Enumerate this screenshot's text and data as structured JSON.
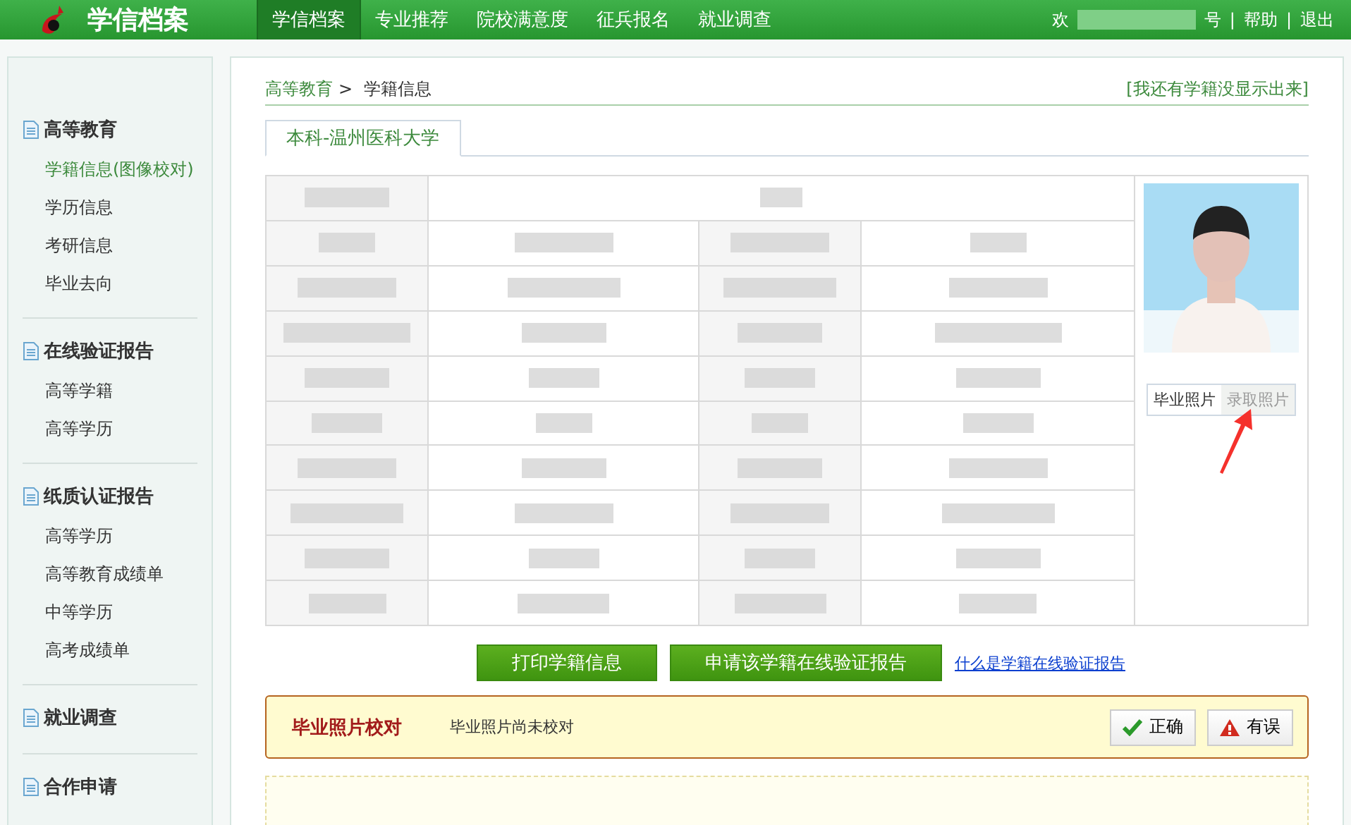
{
  "header": {
    "logo_text": "学信档案",
    "nav": [
      {
        "label": "学信档案",
        "selected": true
      },
      {
        "label": "专业推荐",
        "selected": false
      },
      {
        "label": "院校满意度",
        "selected": false
      },
      {
        "label": "征兵报名",
        "selected": false
      },
      {
        "label": "就业调查",
        "selected": false
      }
    ],
    "welcome_start": "欢",
    "welcome_end": "号",
    "links": [
      "帮助",
      "退出"
    ],
    "separator": "|"
  },
  "sidebar": [
    {
      "title": "高等教育",
      "items": [
        {
          "label": "学籍信息(图像校对)",
          "selected": true
        },
        {
          "label": "学历信息",
          "selected": false
        },
        {
          "label": "考研信息",
          "selected": false
        },
        {
          "label": "毕业去向",
          "selected": false
        }
      ]
    },
    {
      "title": "在线验证报告",
      "items": [
        {
          "label": "高等学籍",
          "selected": false
        },
        {
          "label": "高等学历",
          "selected": false
        }
      ]
    },
    {
      "title": "纸质认证报告",
      "items": [
        {
          "label": "高等学历",
          "selected": false
        },
        {
          "label": "高等教育成绩单",
          "selected": false
        },
        {
          "label": "中等学历",
          "selected": false
        },
        {
          "label": "高考成绩单",
          "selected": false
        }
      ]
    },
    {
      "title": "就业调查"
    },
    {
      "title": "合作申请"
    }
  ],
  "breadcrumb": {
    "parent": "高等教育",
    "separator": ">",
    "current": "学籍信息"
  },
  "missing_link": "[我还有学籍没显示出来]",
  "tabs": [
    {
      "label": "本科-温州医科大学",
      "selected": true
    }
  ],
  "table": {
    "rows": [
      {
        "kind": "wide"
      },
      {
        "kind": "pair"
      },
      {
        "kind": "pair"
      },
      {
        "kind": "pair"
      },
      {
        "kind": "pair"
      },
      {
        "kind": "pair"
      },
      {
        "kind": "pair"
      },
      {
        "kind": "pair"
      },
      {
        "kind": "pair"
      },
      {
        "kind": "pair"
      }
    ]
  },
  "photo_tabs": [
    {
      "label": "毕业照片",
      "selected": true
    },
    {
      "label": "录取照片",
      "selected": false
    }
  ],
  "actions": [
    "打印学籍信息",
    "申请该学籍在线验证报告"
  ],
  "help_link": "什么是学籍在线验证报告",
  "notice": {
    "title": "毕业照片校对",
    "message": "毕业照片尚未校对",
    "buttons": [
      {
        "kind": "ok",
        "label": "正确"
      },
      {
        "kind": "error",
        "label": "有误"
      }
    ]
  }
}
